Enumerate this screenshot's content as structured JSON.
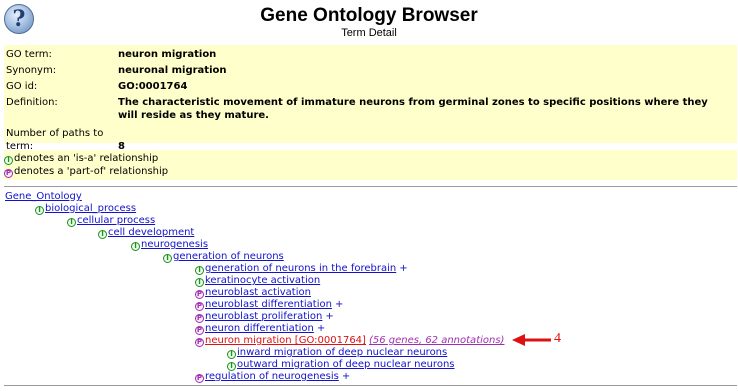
{
  "header": {
    "help_glyph": "?",
    "title": "Gene Ontology Browser",
    "subtitle": "Term Detail"
  },
  "term": {
    "go_term_label": "GO term:",
    "go_term": "neuron migration",
    "synonym_label": "Synonym:",
    "synonym": "neuronal migration",
    "go_id_label": "GO id:",
    "go_id": "GO:0001764",
    "definition_label": "Definition:",
    "definition": "The characteristic movement of immature neurons from germinal zones to specific positions where they will reside as they mature.",
    "paths_label": "Number of paths to term:",
    "paths": "8"
  },
  "legend": {
    "isa_glyph": "I",
    "isa_text": "denotes an 'is-a' relationship",
    "partof_glyph": "P",
    "partof_text": "denotes a 'part-of' relationship"
  },
  "tree": {
    "root": "Gene_Ontology",
    "n1": "biological_process",
    "n2": "cellular process",
    "n3": "cell development",
    "n4": "neurogenesis",
    "n5": "generation of neurons",
    "c1": "generation of neurons in the forebrain",
    "c2": "keratinocyte activation",
    "c3": "neuroblast activation",
    "c4": "neuroblast differentiation",
    "c5": "neuroblast proliferation",
    "c6": "neuron differentiation",
    "current": "neuron migration [GO:0001764]",
    "current_stats": "(56 genes, 62 annotations)",
    "g1": "inward migration of deep nuclear neurons",
    "g2": "outward migration of deep nuclear neurons",
    "c8": "regulation of neurogenesis",
    "plus": "+"
  },
  "annotation": {
    "marker": "4",
    "color": "#dd1111"
  },
  "colors": {
    "term_bg": "#ffffcc",
    "link": "#1212cc",
    "current_term": "#dd1111",
    "isa_icon": "#1e8f1e",
    "partof_icon": "#a02fb0"
  }
}
